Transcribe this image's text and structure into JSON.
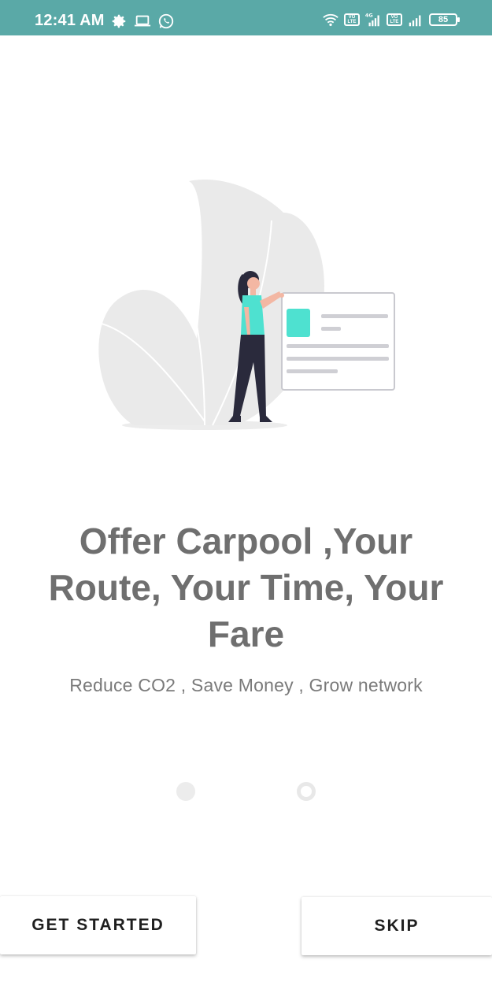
{
  "status_bar": {
    "time": "12:41 AM",
    "battery": "85",
    "volte_label": "Vo\nLTE",
    "network_type": "4G",
    "background_color": "#5aa9a7",
    "left_icons": [
      "gear-icon",
      "laptop-icon",
      "whatsapp-icon"
    ],
    "right_icons": [
      "wifi-icon",
      "volte-icon",
      "4g-signal-icon",
      "volte-icon",
      "signal-icon",
      "battery-icon"
    ]
  },
  "onboarding": {
    "headline": "Offer Carpool ,Your Route, Your Time, Your Fare",
    "subtitle": "Reduce CO2 , Save Money , Grow network",
    "page_count": 2
  },
  "buttons": {
    "get_started": "GET STARTED",
    "skip": "SKIP"
  },
  "colors": {
    "accent": "#4ee1d0",
    "headline": "#6f6f6f",
    "leaf": "#eaeaea"
  }
}
